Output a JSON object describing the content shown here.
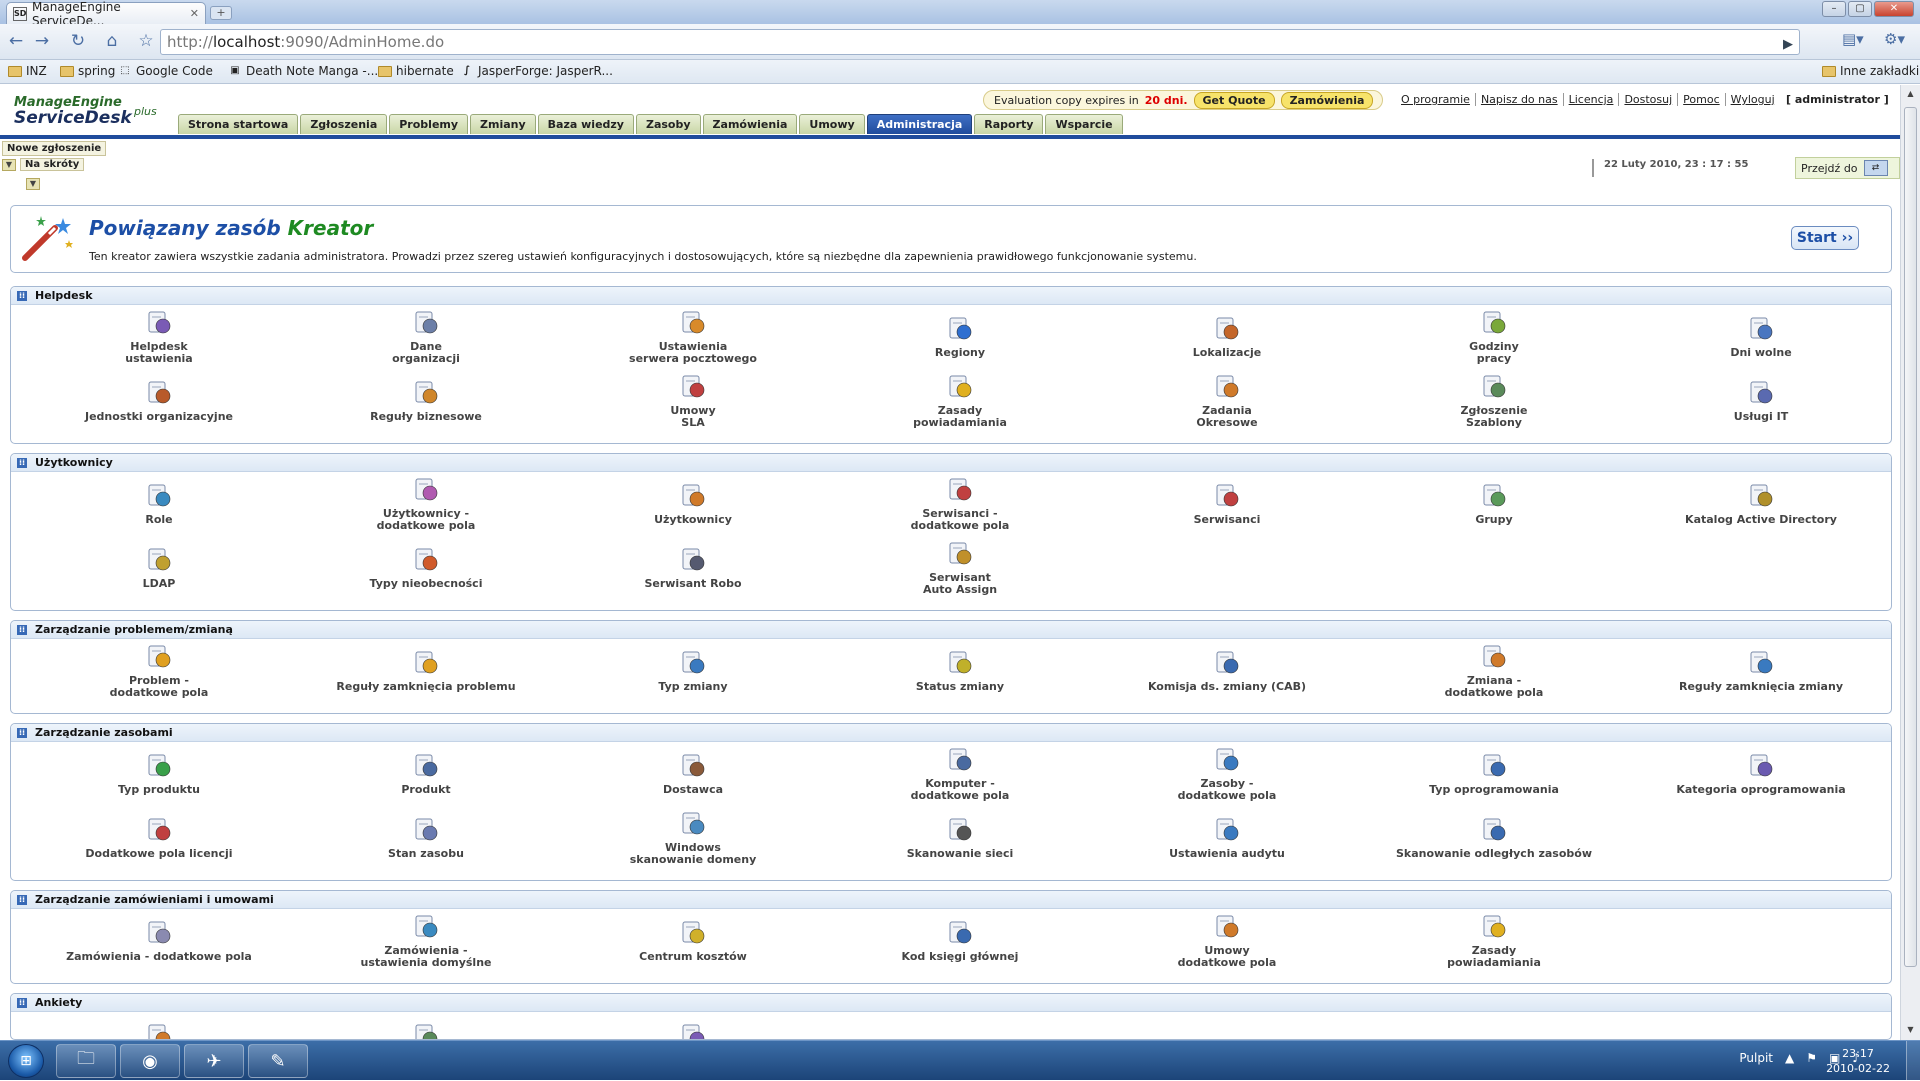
{
  "browser": {
    "tab_title": "ManageEngine ServiceDe...",
    "tab_favicon": "SD",
    "url_prefix": "http://",
    "url_host": "localhost",
    "url_rest": ":9090/AdminHome.do",
    "bookmarks": [
      {
        "label": "INZ",
        "icon": "folder"
      },
      {
        "label": "spring",
        "icon": "folder"
      },
      {
        "label": "Google Code",
        "icon": "google-code"
      },
      {
        "label": "Death Note Manga -...",
        "icon": "dn"
      },
      {
        "label": "hibernate",
        "icon": "folder"
      },
      {
        "label": "JasperForge: JasperR...",
        "icon": "jasper"
      }
    ],
    "other_bookmarks": "Inne zakładki"
  },
  "app": {
    "logo_top": "ManageEngine",
    "logo_main": "ServiceDesk",
    "logo_plus": "plus",
    "eval_text": "Evaluation copy expires in",
    "eval_days": "20 dni.",
    "get_quote": "Get Quote",
    "orders_btn": "Zamówienia",
    "top_links": [
      "O programie",
      "Napisz do nas",
      "Licencja",
      "Dostosuj",
      "Pomoc",
      "Wyloguj"
    ],
    "user": "[ administrator ]",
    "tabs": [
      "Strona startowa",
      "Zgłoszenia",
      "Problemy",
      "Zmiany",
      "Baza wiedzy",
      "Zasoby",
      "Zamówienia",
      "Umowy",
      "Administracja",
      "Raporty",
      "Wsparcie"
    ],
    "active_tab": "Administracja",
    "new_ticket": "Nowe zgłoszenie",
    "shortcuts": "Na skróty",
    "datetime": "22 Luty 2010, 23 : 17 : 55",
    "goto": "Przejdź do"
  },
  "wizard": {
    "title_main": "Powiązany zasób",
    "title_accent": "Kreator",
    "description": "Ten kreator zawiera wszystkie zadania administratora. Prowadzi przez szereg ustawień konfiguracyjnych i dostosowujących, które są niezbędne dla zapewnienia prawidłowego funkcjonowanie systemu.",
    "start": "Start"
  },
  "sections": [
    {
      "title": "Helpdesk",
      "items": [
        {
          "label": "Helpdesk\nustawienia",
          "icon": "helpdesk-settings",
          "color": "#7a5bb5"
        },
        {
          "label": "Dane\norganizacji",
          "icon": "building",
          "color": "#6c7fa8"
        },
        {
          "label": "Ustawienia\nserwera pocztowego",
          "icon": "mail-server",
          "color": "#d88a2a"
        },
        {
          "label": "Regiony",
          "icon": "globe",
          "color": "#2f6fd0"
        },
        {
          "label": "Lokalizacje",
          "icon": "house",
          "color": "#c4662a"
        },
        {
          "label": "Godziny\npracy",
          "icon": "clock",
          "color": "#7aa83a"
        },
        {
          "label": "Dni wolne",
          "icon": "calendar",
          "color": "#4a76c0"
        },
        {
          "label": "Jednostki organizacyjne",
          "icon": "org-units",
          "color": "#b85a2a"
        },
        {
          "label": "Reguły biznesowe",
          "icon": "business-rules",
          "color": "#d0862a"
        },
        {
          "label": "Umowy\nSLA",
          "icon": "sla",
          "color": "#c04040"
        },
        {
          "label": "Zasady\npowiadamiania",
          "icon": "warning",
          "color": "#e0b020"
        },
        {
          "label": "Zadania\nOkresowe",
          "icon": "tasks",
          "color": "#d07a2a"
        },
        {
          "label": "Zgłoszenie\nSzablony",
          "icon": "template",
          "color": "#5a8a5a"
        },
        {
          "label": "Usługi IT",
          "icon": "it-services",
          "color": "#5a6ab0"
        }
      ]
    },
    {
      "title": "Użytkownicy",
      "items": [
        {
          "label": "Role",
          "icon": "roles",
          "color": "#3a8ac0"
        },
        {
          "label": "Użytkownicy -\ndodatkowe pola",
          "icon": "user-fields",
          "color": "#b05ab0"
        },
        {
          "label": "Użytkownicy",
          "icon": "users",
          "color": "#d07a2a"
        },
        {
          "label": "Serwisanci -\ndodatkowe pola",
          "icon": "tech-fields",
          "color": "#c04040"
        },
        {
          "label": "Serwisanci",
          "icon": "technicians",
          "color": "#c04040"
        },
        {
          "label": "Grupy",
          "icon": "groups",
          "color": "#5a9a5a"
        },
        {
          "label": "Katalog Active Directory",
          "icon": "active-directory",
          "color": "#b0902a"
        },
        {
          "label": "LDAP",
          "icon": "ldap",
          "color": "#c0a030"
        },
        {
          "label": "Typy nieobecności",
          "icon": "leave-types",
          "color": "#d05a2a"
        },
        {
          "label": "Serwisant Robo",
          "icon": "robot",
          "color": "#555a70"
        },
        {
          "label": "Serwisant\nAuto Assign",
          "icon": "auto-assign",
          "color": "#c0902a"
        }
      ]
    },
    {
      "title": "Zarządzanie problemem/zmianą",
      "items": [
        {
          "label": "Problem -\ndodatkowe pola",
          "icon": "problem-fields",
          "color": "#e0a020"
        },
        {
          "label": "Reguły zamknięcia problemu",
          "icon": "problem-closure",
          "color": "#e0a020"
        },
        {
          "label": "Typ zmiany",
          "icon": "change-type",
          "color": "#3a7ac0"
        },
        {
          "label": "Status zmiany",
          "icon": "change-status",
          "color": "#c0b02a"
        },
        {
          "label": "Komisja ds. zmiany (CAB)",
          "icon": "cab",
          "color": "#3a6ab0"
        },
        {
          "label": "Zmiana -\ndodatkowe pola",
          "icon": "change-fields",
          "color": "#d07a2a"
        },
        {
          "label": "Reguły zamknięcia zmiany",
          "icon": "change-closure",
          "color": "#3a7ac0"
        }
      ]
    },
    {
      "title": "Zarządzanie zasobami",
      "items": [
        {
          "label": "Typ produktu",
          "icon": "product-type",
          "color": "#3aa04a"
        },
        {
          "label": "Produkt",
          "icon": "product",
          "color": "#4a6aa0"
        },
        {
          "label": "Dostawca",
          "icon": "vendor",
          "color": "#8a5a3a"
        },
        {
          "label": "Komputer -\ndodatkowe pola",
          "icon": "computer-fields",
          "color": "#4a6aa0"
        },
        {
          "label": "Zasoby -\ndodatkowe pola",
          "icon": "asset-fields",
          "color": "#3a7ac0"
        },
        {
          "label": "Typ oprogramowania",
          "icon": "software-type",
          "color": "#3a6ab0"
        },
        {
          "label": "Kategoria oprogramowania",
          "icon": "software-category",
          "color": "#6a5ab0"
        },
        {
          "label": "Dodatkowe pola licencji",
          "icon": "license-fields",
          "color": "#c04040"
        },
        {
          "label": "Stan zasobu",
          "icon": "asset-state",
          "color": "#6a7ab0"
        },
        {
          "label": "Windows\nskanowanie domeny",
          "icon": "windows-scan",
          "color": "#4a8ac0"
        },
        {
          "label": "Skanowanie sieci",
          "icon": "network-scan",
          "color": "#555555"
        },
        {
          "label": "Ustawienia audytu",
          "icon": "audit-settings",
          "color": "#3a7ac0"
        },
        {
          "label": "Skanowanie odległych zasobów",
          "icon": "remote-scan",
          "color": "#3a6ab0"
        }
      ]
    },
    {
      "title": "Zarządzanie zamówieniami i umowami",
      "items": [
        {
          "label": "Zamówienia - dodatkowe pola",
          "icon": "po-fields",
          "color": "#8a8ab0"
        },
        {
          "label": "Zamówienia -\nustawienia domyślne",
          "icon": "po-defaults",
          "color": "#3a8ac0"
        },
        {
          "label": "Centrum kosztów",
          "icon": "cost-center",
          "color": "#d0b02a"
        },
        {
          "label": "Kod księgi głównej",
          "icon": "gl-code",
          "color": "#3a6ab0"
        },
        {
          "label": "Umowy\ndodatkowe pola",
          "icon": "contract-fields",
          "color": "#d07a2a"
        },
        {
          "label": "Zasady\npowiadamiania",
          "icon": "warning",
          "color": "#e0b020"
        }
      ]
    },
    {
      "title": "Ankiety",
      "items": [
        {
          "label": "",
          "icon": "survey-1",
          "color": "#d07a2a"
        },
        {
          "label": "",
          "icon": "survey-2",
          "color": "#5a8a5a"
        },
        {
          "label": "",
          "icon": "survey-3",
          "color": "#7a5bb5"
        }
      ]
    }
  ],
  "taskbar": {
    "desktop_label": "Pulpit",
    "time": "23:17",
    "date": "2010-02-22"
  }
}
